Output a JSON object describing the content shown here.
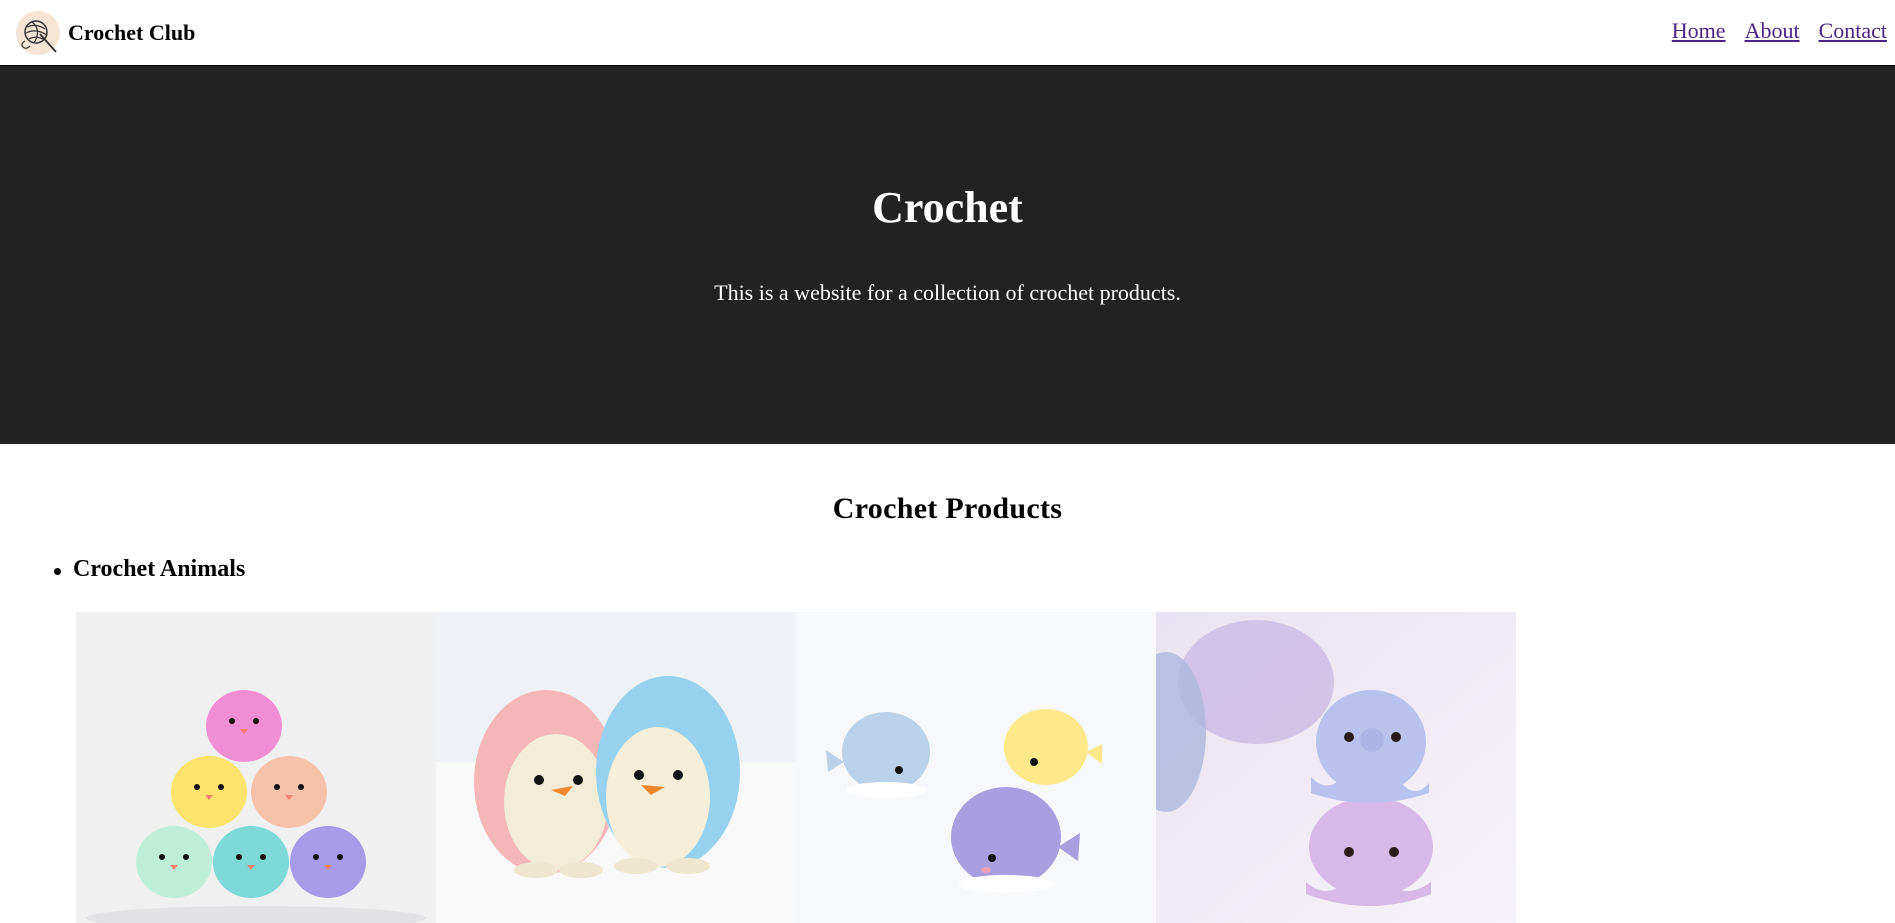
{
  "header": {
    "logo_icon": "yarn-ball-crochet-hook-icon",
    "brand": "Crochet Club",
    "nav": [
      "Home",
      "About",
      "Contact"
    ]
  },
  "hero": {
    "title": "Crochet",
    "subtitle": "This is a website for a collection of crochet products."
  },
  "products": {
    "title": "Crochet Products",
    "category": "Crochet Animals",
    "images": [
      "birds-pyramid-image",
      "penguins-image",
      "whales-image",
      "octopuses-image"
    ]
  },
  "colors": {
    "hero_bg": "#222222",
    "link": "#4c2487"
  }
}
